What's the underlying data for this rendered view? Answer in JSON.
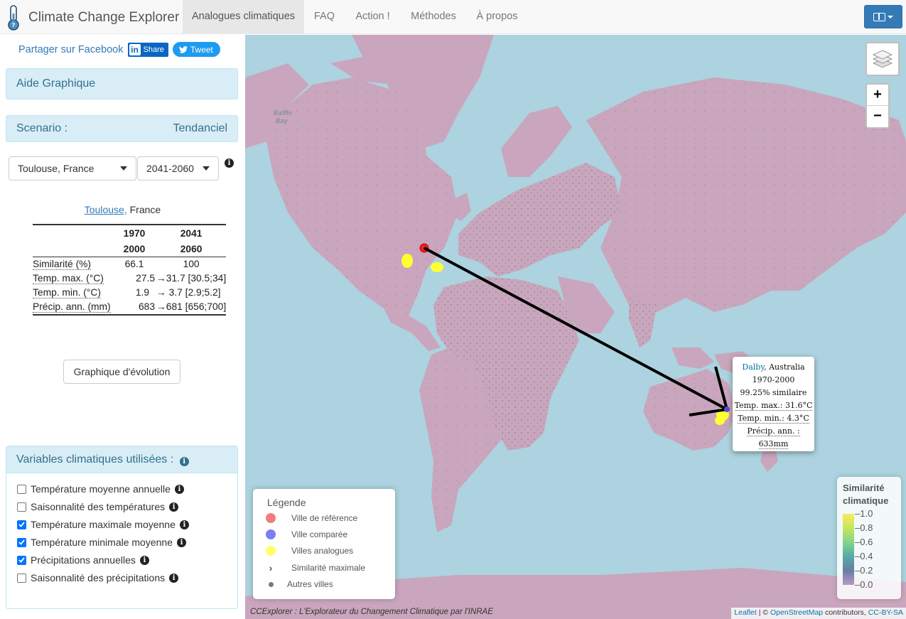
{
  "app": {
    "title": "Climate Change Explorer"
  },
  "nav": {
    "tabs": [
      {
        "label": "Analogues climatiques"
      },
      {
        "label": "FAQ"
      },
      {
        "label": "Action !"
      },
      {
        "label": "Méthodes"
      },
      {
        "label": "À propos"
      }
    ]
  },
  "share": {
    "facebook": "Partager sur Facebook",
    "linkedin": "Share",
    "twitter": "Tweet"
  },
  "sidebar": {
    "help_title": "Aide Graphique",
    "scenario_label": "Scenario :",
    "scenario_value": "Tendanciel",
    "city_select": "Toulouse, France",
    "period_select": "2041-2060",
    "city_link": "Toulouse,",
    "city_country": " France",
    "table": {
      "col1_top": "1970",
      "col1_bottom": "2000",
      "col2_top": "2041",
      "col2_bottom": "2060",
      "rows": [
        {
          "label": "Similarité (%)",
          "v1": "66.1",
          "v2": "100"
        },
        {
          "label": "Temp. max. (°C)",
          "v1": "27.5",
          "v2": "→31.7 [30.5;34]"
        },
        {
          "label": "Temp. min. (°C)",
          "v1": "1.9",
          "v2": "→ 3.7 [2.9;5.2]"
        },
        {
          "label": "Précip. ann. (mm)",
          "v1": "683",
          "v2": "→681 [656;700]"
        }
      ]
    },
    "evolution_button": "Graphique d'évolution",
    "variables_title": "Variables climatiques utilisées :",
    "variables": [
      {
        "label": "Température moyenne annuelle",
        "checked": false
      },
      {
        "label": "Saisonnalité des températures",
        "checked": false
      },
      {
        "label": "Température maximale moyenne",
        "checked": true
      },
      {
        "label": "Température minimale moyenne",
        "checked": true
      },
      {
        "label": "Précipitations annuelles",
        "checked": true
      },
      {
        "label": "Saisonnalité des précipitations",
        "checked": false
      }
    ]
  },
  "map": {
    "place_label": "Baffin\nBay",
    "legend": {
      "title": "Légende",
      "items": [
        {
          "label": "Ville de référence",
          "color": "#f47c7c"
        },
        {
          "label": "Ville comparée",
          "color": "#7d7df5"
        },
        {
          "label": "Villes analogues",
          "color": "#ffff66"
        },
        {
          "label": "Similarité maximale",
          "color": "#555555"
        },
        {
          "label": "Autres villes",
          "color": "#777777"
        }
      ]
    },
    "similarity_legend": {
      "title_line1": "Similarité",
      "title_line2": "climatique",
      "ticks": [
        "1.0",
        "0.8",
        "0.6",
        "0.4",
        "0.2",
        "0.0"
      ]
    },
    "popup": {
      "city": "Dalby",
      "country": ", Australia",
      "period": "1970-2000",
      "similarity": "99.25% similaire",
      "tmax": "Temp. max.: 31.6°C",
      "tmin": "Temp. min.: 4.3°C",
      "precip": "Précip. ann. : 633mm"
    },
    "attribution": {
      "leaflet": "Leaflet",
      "sep": " | © ",
      "osm": "OpenStreetMap",
      "contrib": " contributors, ",
      "license": "CC-BY-SA"
    },
    "credit": "CCExplorer : L'Explorateur du Changement Climatique par l'INRAE",
    "zoom_in": "+",
    "zoom_out": "−"
  },
  "colors": {
    "accent": "#337ab7",
    "panel": "#d9edf7",
    "reference": "#e02020",
    "analogue": "#ffff33"
  }
}
